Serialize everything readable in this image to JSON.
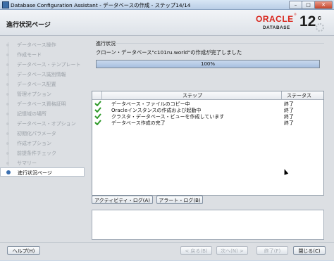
{
  "window": {
    "title": "Database Configuration Assistant - データベースの作成 - ステップ14/14",
    "controls": {
      "minimize": "–",
      "maximize": "□",
      "close": "✕"
    }
  },
  "header": {
    "page_title": "進行状況ページ",
    "brand": {
      "name": "ORACLE",
      "registered": "®",
      "product": "DATABASE",
      "version": "12",
      "version_suffix": "c"
    }
  },
  "nav": {
    "items": [
      {
        "label": "データベース操作",
        "active": false
      },
      {
        "label": "作成モード",
        "active": false
      },
      {
        "label": "データベース・テンプレート",
        "active": false
      },
      {
        "label": "データベース識別情報",
        "active": false
      },
      {
        "label": "データベース配置",
        "active": false
      },
      {
        "label": "管理オプション",
        "active": false
      },
      {
        "label": "データベース資格証明",
        "active": false
      },
      {
        "label": "記憶域の場所",
        "active": false
      },
      {
        "label": "データベース・オプション",
        "active": false
      },
      {
        "label": "初期化パラメータ",
        "active": false
      },
      {
        "label": "作成オプション",
        "active": false
      },
      {
        "label": "前提条件チェック",
        "active": false
      },
      {
        "label": "サマリー",
        "active": false
      },
      {
        "label": "進行状況ページ",
        "active": true
      }
    ]
  },
  "progress": {
    "section_label": "進行状況",
    "message": "クローン・データベース\"c101ru.world\"の作成が完了しました",
    "percent": 100,
    "percent_text": "100%"
  },
  "steps": {
    "columns": {
      "step": "ステップ",
      "status": "ステータス"
    },
    "rows": [
      {
        "step": "データベース・ファイルのコピー中",
        "status": "終了"
      },
      {
        "step": "Oracleインスタンスの作成および起動中",
        "status": "終了"
      },
      {
        "step": "クラスタ・データベース・ビューを作成しています",
        "status": "終了"
      },
      {
        "step": "データベース作成の完了",
        "status": "終了"
      }
    ]
  },
  "buttons": {
    "activity_log": "アクティビティ・ログ(A)",
    "alert_log": "アラート・ログ(B)",
    "help": "ヘルプ(H)",
    "back": "< 戻る(B)",
    "next": "次へ(N) >",
    "finish": "終了(F)",
    "close": "閉じる(C)"
  }
}
